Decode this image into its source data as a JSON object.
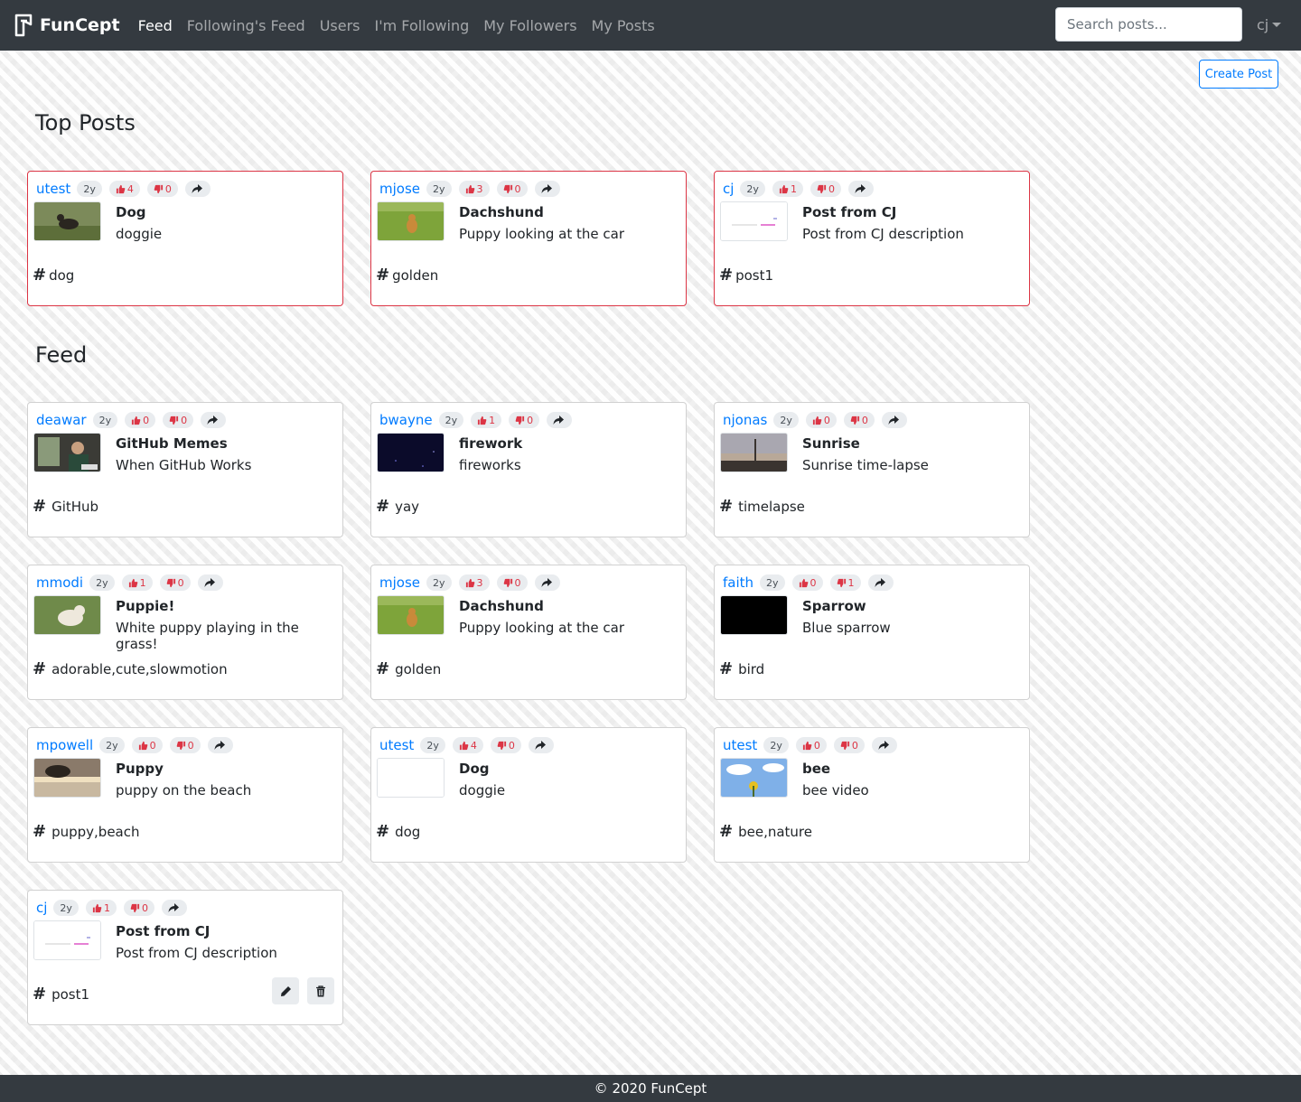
{
  "nav": {
    "brand": "FunCept",
    "links": [
      "Feed",
      "Following's Feed",
      "Users",
      "I'm Following",
      "My Followers",
      "My Posts"
    ],
    "search_placeholder": "Search posts...",
    "user": "cj"
  },
  "create_post_label": "Create Post",
  "sections": {
    "top": "Top Posts",
    "feed": "Feed"
  },
  "colors": {
    "accent": "#007bff",
    "navbar": "#343a40",
    "vote": "#dc3545",
    "top_border": "#dc3545"
  },
  "top_posts": [
    {
      "author": "utest",
      "age": "2y",
      "likes": "4",
      "dislikes": "0",
      "title": "Dog",
      "desc": "doggie",
      "tags": "dog",
      "thumb": "dog-lawn"
    },
    {
      "author": "mjose",
      "age": "2y",
      "likes": "3",
      "dislikes": "0",
      "title": "Dachshund",
      "desc": "Puppy looking at the car",
      "tags": "golden",
      "thumb": "grass-dog"
    },
    {
      "author": "cj",
      "age": "2y",
      "likes": "1",
      "dislikes": "0",
      "title": "Post from CJ",
      "desc": "Post from CJ description",
      "tags": "post1",
      "thumb": "blank-lines"
    }
  ],
  "feed": [
    {
      "author": "deawar",
      "age": "2y",
      "likes": "0",
      "dislikes": "0",
      "title": "GitHub Memes",
      "desc": "When GitHub Works",
      "tags": "GitHub",
      "thumb": "person-screen"
    },
    {
      "author": "bwayne",
      "age": "2y",
      "likes": "1",
      "dislikes": "0",
      "title": "firework",
      "desc": "fireworks",
      "tags": "yay",
      "thumb": "night-sky"
    },
    {
      "author": "njonas",
      "age": "2y",
      "likes": "0",
      "dislikes": "0",
      "title": "Sunrise",
      "desc": "Sunrise time-lapse",
      "tags": "timelapse",
      "thumb": "sunrise-city"
    },
    {
      "author": "mmodi",
      "age": "2y",
      "likes": "1",
      "dislikes": "0",
      "title": "Puppie!",
      "desc": "White puppy playing in the grass!",
      "tags": "adorable,cute,slowmotion",
      "thumb": "white-puppy"
    },
    {
      "author": "mjose",
      "age": "2y",
      "likes": "3",
      "dislikes": "0",
      "title": "Dachshund",
      "desc": "Puppy looking at the car",
      "tags": "golden",
      "thumb": "grass-dog"
    },
    {
      "author": "faith",
      "age": "2y",
      "likes": "0",
      "dislikes": "1",
      "title": "Sparrow",
      "desc": "Blue sparrow",
      "tags": "bird",
      "thumb": "black"
    },
    {
      "author": "mpowell",
      "age": "2y",
      "likes": "0",
      "dislikes": "0",
      "title": "Puppy",
      "desc": "puppy on the beach",
      "tags": "puppy,beach",
      "thumb": "beach-dog"
    },
    {
      "author": "utest",
      "age": "2y",
      "likes": "4",
      "dislikes": "0",
      "title": "Dog",
      "desc": "doggie",
      "tags": "dog",
      "thumb": "blank"
    },
    {
      "author": "utest",
      "age": "2y",
      "likes": "0",
      "dislikes": "0",
      "title": "bee",
      "desc": "bee video",
      "tags": "bee,nature",
      "thumb": "flower-sky"
    },
    {
      "author": "cj",
      "age": "2y",
      "likes": "1",
      "dislikes": "0",
      "title": "Post from CJ",
      "desc": "Post from CJ description",
      "tags": "post1",
      "thumb": "blank-lines",
      "own": true
    }
  ],
  "footer": "© 2020 FunCept"
}
